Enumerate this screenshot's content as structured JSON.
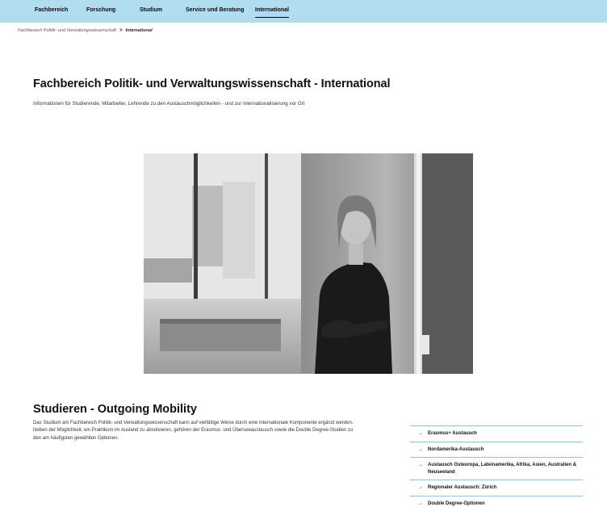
{
  "nav": {
    "items": [
      {
        "label": "Fachbereich"
      },
      {
        "label": "Forschung"
      },
      {
        "label": "Studium"
      },
      {
        "label": "Service und Beratung"
      },
      {
        "label": "International"
      }
    ]
  },
  "breadcrumb": {
    "parent": "Fachbereich Politik- und Verwaltungswissenschaft",
    "current": "International"
  },
  "header": {
    "title": "Fachbereich Politik- und Verwaltungswissenschaft - International",
    "intro": "Informationen für Studierende, Mitarbeiter, Lehrende zu den Austauschmöglichkeiten - und zur Internationalisierung vor Ort"
  },
  "outgoing": {
    "title": "Studieren - Outgoing Mobility",
    "text": "Das Studium am Fachbereich Politik- und Verwaltungswissenschaft kann auf vielfältige Weise durch eine internationale Komponente ergänzt werden. Neben der Möglichkeit, ein Praktikum im Ausland zu absolvieren, gehören der Erasmus- und Überseeaustausch sowie die Double Degree-Studien zu den am häufigsten gewählten Optionen.",
    "links": [
      {
        "label": "Erasmus+ Austausch"
      },
      {
        "label": "Nordamerika-Austausch"
      },
      {
        "label": "Austausch Osteuropa, Lateinamerika, Afrika, Asien, Australien & Neuseeland"
      },
      {
        "label": "Regionaler Austausch: Zürich"
      },
      {
        "label": "Double Degree-Optionen"
      }
    ]
  }
}
